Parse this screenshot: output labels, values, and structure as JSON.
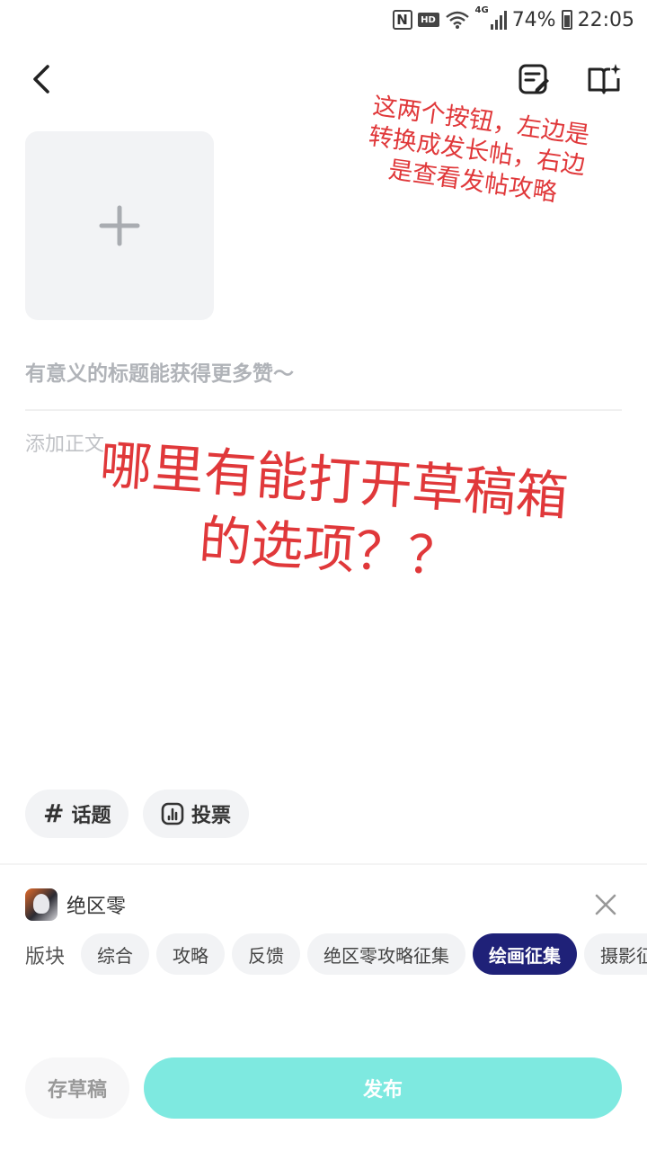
{
  "status_bar": {
    "nfc": "N",
    "hd": "HD",
    "network": "4G",
    "battery": "74%",
    "time": "22:05"
  },
  "header": {
    "back_icon": "chevron-left-icon",
    "convert_long_post_icon": "note-edit-icon",
    "posting_guide_icon": "open-book-sparkle-icon"
  },
  "composer": {
    "image_add_icon": "plus-icon",
    "title_placeholder": "有意义的标题能获得更多赞～",
    "body_placeholder": "添加正文"
  },
  "annotations": {
    "note_small": "这两个按钮，左边是转换成发长帖，右边是查看发帖攻略",
    "note_big": "哪里有能打开草稿箱的选项？？",
    "color": "#e0383a"
  },
  "chips": {
    "topic": "话题",
    "vote": "投票"
  },
  "game": {
    "name": "绝区零"
  },
  "board": {
    "label": "版块",
    "tags": [
      "综合",
      "攻略",
      "反馈",
      "绝区零攻略征集",
      "绘画征集",
      "摄影征集"
    ],
    "selected": "绘画征集"
  },
  "bottom": {
    "draft_label": "存草稿",
    "publish_label": "发布"
  },
  "colors": {
    "accent_selected": "#1f2178",
    "publish": "#7ee9e0",
    "placeholder": "#b0b3b8"
  }
}
